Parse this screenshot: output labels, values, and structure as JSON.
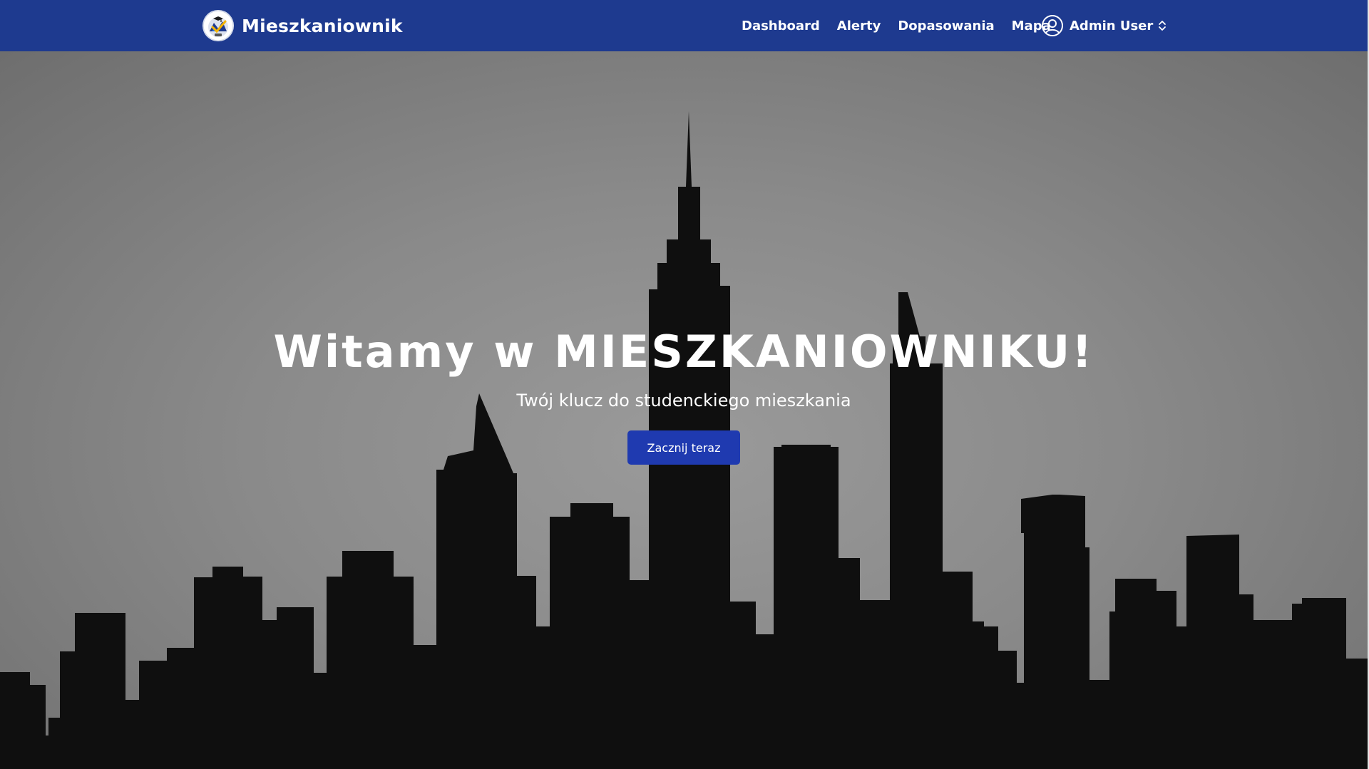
{
  "navbar": {
    "brand": "Mieszkaniownik",
    "links": [
      "Dashboard",
      "Alerty",
      "Dopasowania",
      "Mapa"
    ],
    "user": {
      "name": "Admin User",
      "icon": "user-circle-icon",
      "toggle_icon": "chevron-up-down-icon"
    }
  },
  "hero": {
    "title": "Witamy w MIESZKANIOWNIKU!",
    "subtitle": "Twój klucz do studenckiego mieszkania",
    "cta_label": "Zacznij teraz"
  },
  "colors": {
    "navbar": "#1e3a8f",
    "cta": "#1f3ab0",
    "skyline": "#0f0f0f",
    "sky": "#8a8a8a"
  }
}
